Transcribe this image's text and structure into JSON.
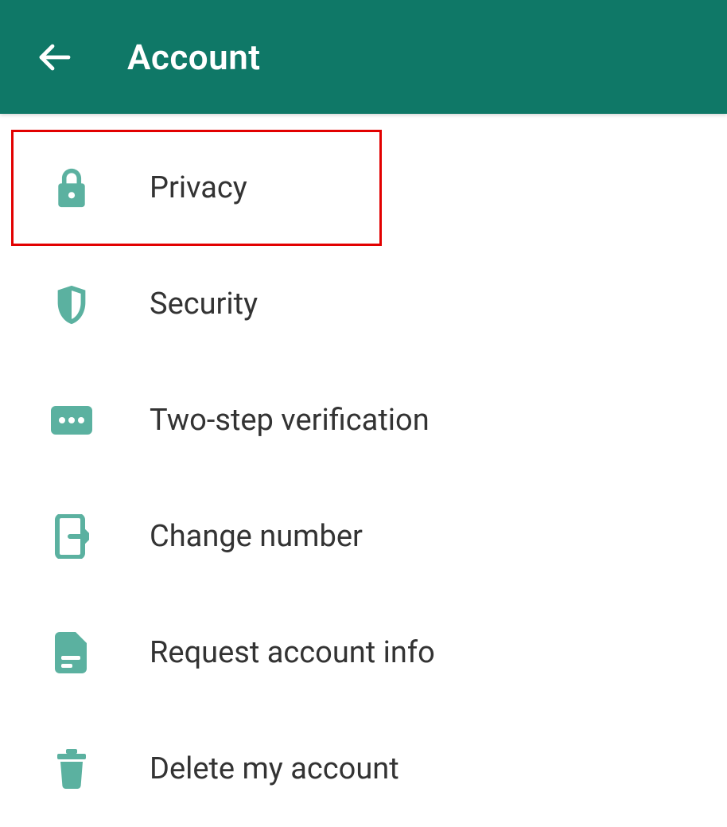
{
  "header": {
    "title": "Account"
  },
  "items": [
    {
      "label": "Privacy",
      "icon": "lock",
      "highlighted": true
    },
    {
      "label": "Security",
      "icon": "shield",
      "highlighted": false
    },
    {
      "label": "Two-step verification",
      "icon": "dots",
      "highlighted": false
    },
    {
      "label": "Change number",
      "icon": "change",
      "highlighted": false
    },
    {
      "label": "Request account info",
      "icon": "doc",
      "highlighted": false
    },
    {
      "label": "Delete my account",
      "icon": "trash",
      "highlighted": false
    }
  ],
  "colors": {
    "accent": "#5bb1a0",
    "headerBg": "#0f7867",
    "text": "#333333",
    "highlight": "#e20000"
  }
}
